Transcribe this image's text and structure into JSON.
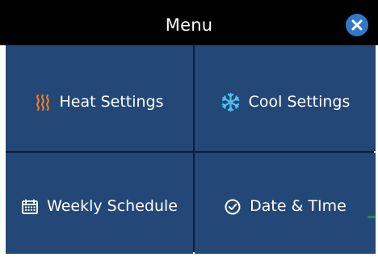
{
  "header": {
    "title": "Menu",
    "close_icon": "close-icon"
  },
  "menu": {
    "items": [
      {
        "label": "Heat Settings",
        "icon": "heat-icon",
        "icon_color": "#f07b22"
      },
      {
        "label": "Cool Settings",
        "icon": "snowflake-icon",
        "icon_color": "#4bc3f0"
      },
      {
        "label": "Weekly Schedule",
        "icon": "calendar-icon",
        "icon_color": "#ffffff"
      },
      {
        "label": "Date & TIme",
        "icon": "clock-icon",
        "icon_color": "#ffffff"
      }
    ]
  },
  "colors": {
    "title_bar": "#000000",
    "tile_background": "#234777",
    "grid_lines": "#0c1b3b",
    "close_button": "#2f79c8",
    "accent_green": "#1d8f46"
  }
}
